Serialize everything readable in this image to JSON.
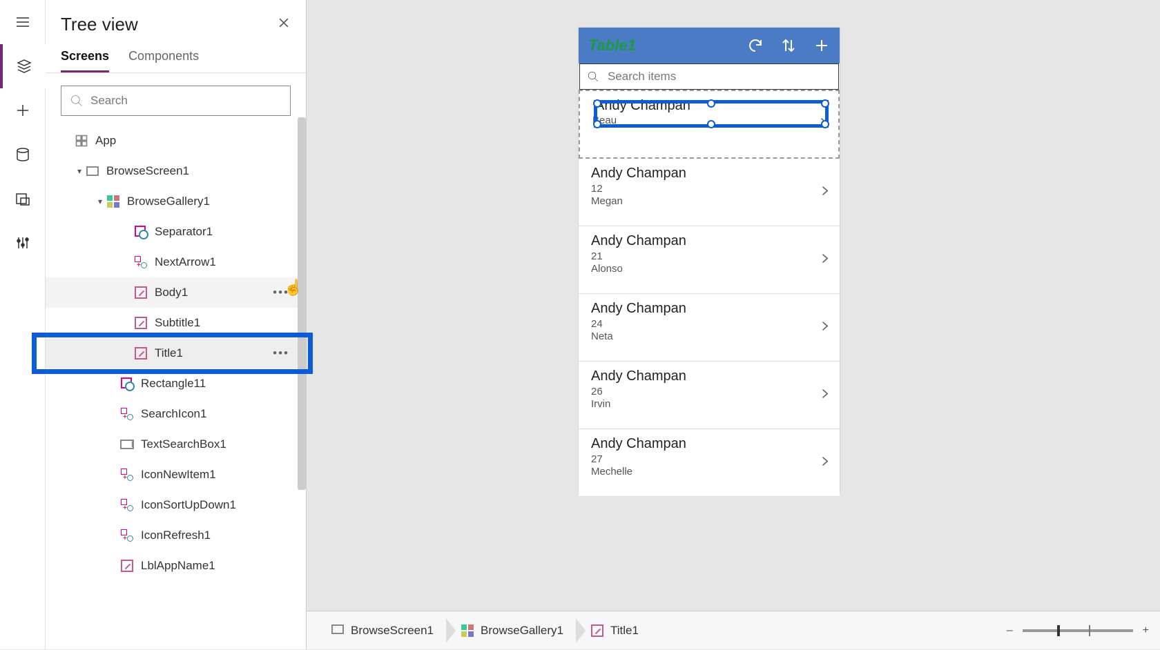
{
  "iconbar": [
    "menu",
    "layers",
    "add",
    "database",
    "media",
    "sliders"
  ],
  "treepanel": {
    "title": "Tree view",
    "tabs": [
      "Screens",
      "Components"
    ],
    "active_tab": 0,
    "search_placeholder": "Search"
  },
  "tree": [
    {
      "level": "level1",
      "icon": "grid-outline",
      "label": "App",
      "chev": ""
    },
    {
      "level": "level2",
      "icon": "box",
      "label": "BrowseScreen1",
      "chev": "▾"
    },
    {
      "level": "level3",
      "icon": "grid",
      "label": "BrowseGallery1",
      "chev": "▾"
    },
    {
      "level": "level4",
      "icon": "shape",
      "label": "Separator1"
    },
    {
      "level": "level4",
      "icon": "gp",
      "label": "NextArrow1"
    },
    {
      "level": "level4",
      "icon": "edit",
      "label": "Body1",
      "hover": true,
      "more": true
    },
    {
      "level": "level4",
      "icon": "edit",
      "label": "Subtitle1"
    },
    {
      "level": "level4",
      "icon": "edit",
      "label": "Title1",
      "selected": true,
      "more": true,
      "highlight": true
    },
    {
      "level": "level3r",
      "icon": "shape",
      "label": "Rectangle11"
    },
    {
      "level": "level3r",
      "icon": "gp",
      "label": "SearchIcon1"
    },
    {
      "level": "level3r",
      "icon": "text",
      "label": "TextSearchBox1"
    },
    {
      "level": "level3r",
      "icon": "gp",
      "label": "IconNewItem1"
    },
    {
      "level": "level3r",
      "icon": "gp",
      "label": "IconSortUpDown1"
    },
    {
      "level": "level3r",
      "icon": "gp",
      "label": "IconRefresh1"
    },
    {
      "level": "level3r",
      "icon": "edit",
      "label": "LblAppName1"
    }
  ],
  "phone": {
    "app_title": "Table1",
    "search_placeholder": "Search items",
    "items": [
      {
        "title": "Andy Champan",
        "subtitle": "",
        "body": "Beau",
        "selected": true
      },
      {
        "title": "Andy Champan",
        "subtitle": "12",
        "body": "Megan"
      },
      {
        "title": "Andy Champan",
        "subtitle": "21",
        "body": "Alonso"
      },
      {
        "title": "Andy Champan",
        "subtitle": "24",
        "body": "Neta"
      },
      {
        "title": "Andy Champan",
        "subtitle": "26",
        "body": "Irvin"
      },
      {
        "title": "Andy Champan",
        "subtitle": "27",
        "body": "Mechelle"
      }
    ]
  },
  "breadcrumb": [
    {
      "icon": "box",
      "label": "BrowseScreen1"
    },
    {
      "icon": "grid",
      "label": "BrowseGallery1"
    },
    {
      "icon": "edit",
      "label": "Title1"
    }
  ],
  "zoom": {
    "minus": "–",
    "plus": "+"
  }
}
